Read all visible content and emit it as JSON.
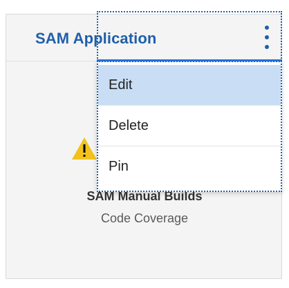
{
  "card": {
    "title": "SAM Application",
    "kebab_icon": "kebab-vertical-icon",
    "warning_icon": "warning-triangle-icon",
    "build_name": "SAM Manual Builds",
    "build_subtitle": "Code Coverage"
  },
  "menu": {
    "items": [
      {
        "label": "Edit",
        "selected": true
      },
      {
        "label": "Delete",
        "selected": false
      },
      {
        "label": "Pin",
        "selected": false
      }
    ]
  },
  "colors": {
    "accent": "#1f5faa",
    "menu_highlight": "#c9def5",
    "warning": "#f1c21b"
  }
}
